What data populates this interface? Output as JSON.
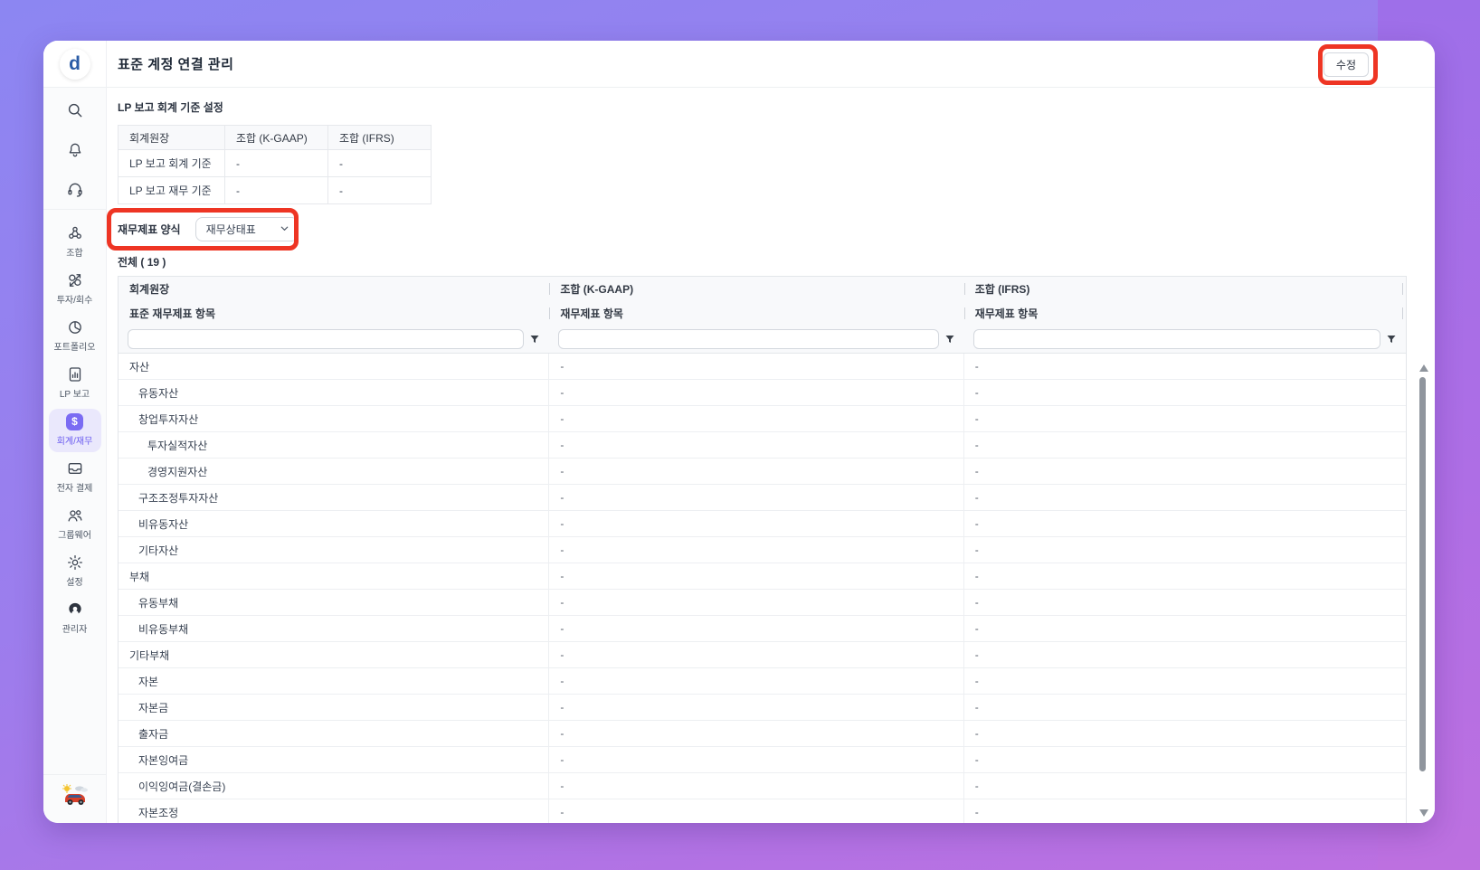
{
  "colors": {
    "background_top": "#8c86f2",
    "background_bottom": "#bd70e1",
    "annotation_red": "#ee3524",
    "active_purple": "#6c5df0",
    "logo_blue": "#2b5ca6"
  },
  "window": {
    "logo_letter": "d",
    "title": "표준 계정 연결 관리",
    "edit_button": "수정"
  },
  "sidebar": {
    "top_icons": [
      {
        "icon": "search-icon"
      },
      {
        "icon": "bell-icon"
      },
      {
        "icon": "headset-icon"
      }
    ],
    "items": [
      {
        "label": "조합",
        "icon": "union-icon",
        "active": false
      },
      {
        "label": "투자/회수",
        "icon": "invest-icon",
        "active": false
      },
      {
        "label": "포트폴리오",
        "icon": "portfolio-icon",
        "active": false
      },
      {
        "label": "LP 보고",
        "icon": "lp-report-icon",
        "active": false
      },
      {
        "label": "회계/재무",
        "icon": "accounting-icon",
        "active": true,
        "badge_glyph": "$"
      },
      {
        "label": "전자 결제",
        "icon": "payment-icon",
        "active": false
      },
      {
        "label": "그룹웨어",
        "icon": "groupware-icon",
        "active": false
      },
      {
        "label": "설정",
        "icon": "settings-icon",
        "active": false
      },
      {
        "label": "관리자",
        "icon": "admin-icon",
        "active": false
      }
    ],
    "mascot": "car-mascot-avatar"
  },
  "lp_section": {
    "title": "LP 보고 회계 기준 설정",
    "headers": [
      "회계원장",
      "조합 (K-GAAP)",
      "조합 (IFRS)"
    ],
    "rows": [
      {
        "label": "LP 보고 회계 기준",
        "kgaap": "-",
        "ifrs": "-"
      },
      {
        "label": "LP 보고 재무 기준",
        "kgaap": "-",
        "ifrs": "-"
      }
    ]
  },
  "form": {
    "label": "재무제표 양식",
    "selected_option": "재무상태표"
  },
  "summary": {
    "total_label": "전체 ( 19 )"
  },
  "main_table": {
    "group_headers": [
      "회계원장",
      "조합 (K-GAAP)",
      "조합 (IFRS)"
    ],
    "sub_headers": [
      "표준 재무제표 항목",
      "재무제표 항목",
      "재무제표 항목"
    ],
    "filter_placeholder": "",
    "rows": [
      {
        "label": "자산",
        "indent": 0,
        "kgaap": "-",
        "ifrs": "-"
      },
      {
        "label": "유동자산",
        "indent": 1,
        "kgaap": "-",
        "ifrs": "-"
      },
      {
        "label": "창업투자자산",
        "indent": 1,
        "kgaap": "-",
        "ifrs": "-"
      },
      {
        "label": "투자실적자산",
        "indent": 2,
        "kgaap": "-",
        "ifrs": "-"
      },
      {
        "label": "경영지원자산",
        "indent": 2,
        "kgaap": "-",
        "ifrs": "-"
      },
      {
        "label": "구조조정투자자산",
        "indent": 1,
        "kgaap": "-",
        "ifrs": "-"
      },
      {
        "label": "비유동자산",
        "indent": 1,
        "kgaap": "-",
        "ifrs": "-"
      },
      {
        "label": "기타자산",
        "indent": 1,
        "kgaap": "-",
        "ifrs": "-"
      },
      {
        "label": "부채",
        "indent": 0,
        "kgaap": "-",
        "ifrs": "-"
      },
      {
        "label": "유동부채",
        "indent": 1,
        "kgaap": "-",
        "ifrs": "-"
      },
      {
        "label": "비유동부채",
        "indent": 1,
        "kgaap": "-",
        "ifrs": "-"
      },
      {
        "label": "기타부채",
        "indent": 0,
        "kgaap": "-",
        "ifrs": "-"
      },
      {
        "label": "자본",
        "indent": 1,
        "kgaap": "-",
        "ifrs": "-"
      },
      {
        "label": "자본금",
        "indent": 1,
        "kgaap": "-",
        "ifrs": "-"
      },
      {
        "label": "출자금",
        "indent": 1,
        "kgaap": "-",
        "ifrs": "-"
      },
      {
        "label": "자본잉여금",
        "indent": 1,
        "kgaap": "-",
        "ifrs": "-"
      },
      {
        "label": "이익잉여금(결손금)",
        "indent": 1,
        "kgaap": "-",
        "ifrs": "-"
      },
      {
        "label": "자본조정",
        "indent": 1,
        "kgaap": "-",
        "ifrs": "-"
      }
    ]
  }
}
